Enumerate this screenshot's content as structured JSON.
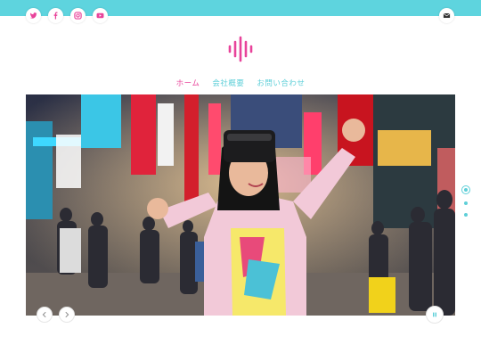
{
  "topbar": {
    "social_icons": [
      "twitter-icon",
      "facebook-icon",
      "instagram-icon",
      "youtube-icon"
    ],
    "mail_icon": "mail-icon",
    "color": "#5ed4de"
  },
  "logo": {
    "icon": "sound-wave-logo",
    "color": "#e8439a"
  },
  "nav": {
    "items": [
      {
        "label": "ホーム",
        "active": true
      },
      {
        "label": "会社概要",
        "active": false
      },
      {
        "label": "お問い合わせ",
        "active": false
      }
    ],
    "active_color": "#e8439a",
    "color": "#5ecfd8"
  },
  "hero": {
    "image": "woman-wearing-vr-headset-in-neon-city-street",
    "prev_icon": "chevron-left-icon",
    "next_icon": "chevron-right-icon",
    "pause_icon": "pause-icon",
    "slide_count": 3,
    "active_slide": 1
  }
}
